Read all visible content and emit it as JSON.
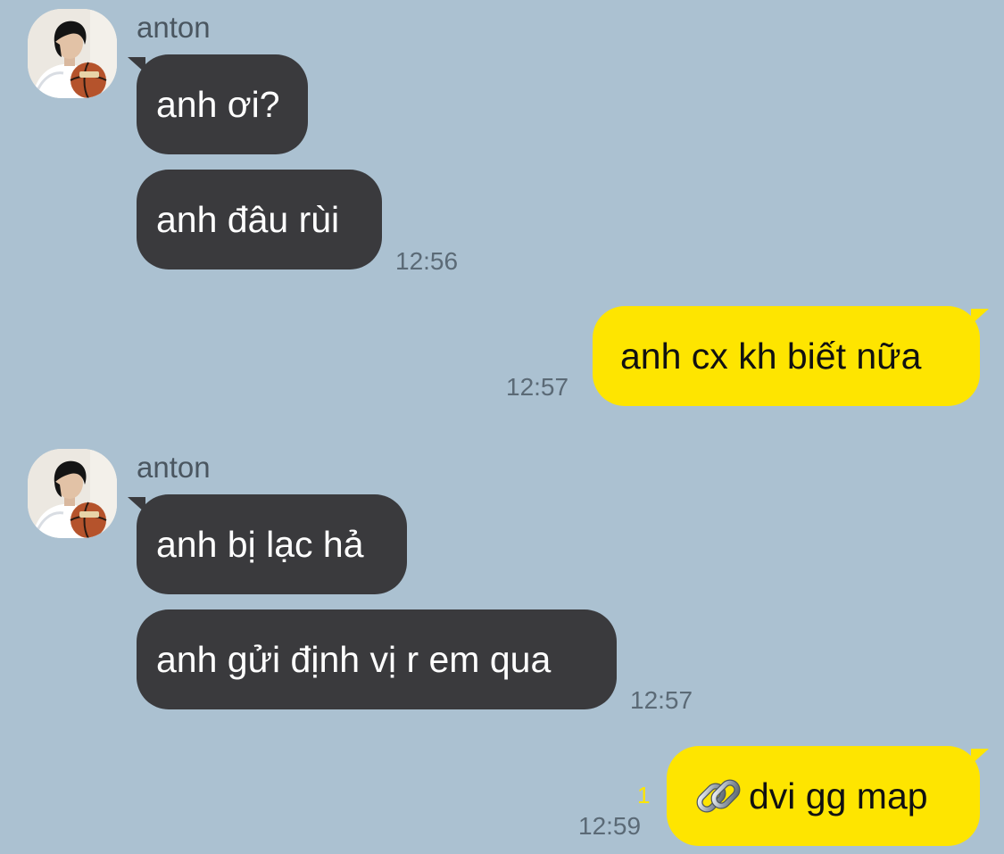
{
  "theme": {
    "background": "#abc1d1",
    "incoming_bubble": "#3a3a3d",
    "outgoing_bubble": "#fee500",
    "unread_color": "#fee500"
  },
  "messages": [
    {
      "direction": "in",
      "sender": "anton",
      "text": "anh ơi?"
    },
    {
      "direction": "in",
      "text": "anh đâu rùi",
      "time": "12:56"
    },
    {
      "direction": "out",
      "text": "anh cx kh biết nữa",
      "time": "12:57"
    },
    {
      "direction": "in",
      "sender": "anton",
      "text": "anh bị lạc hả"
    },
    {
      "direction": "in",
      "text": "anh gửi định vị r em qua",
      "time": "12:57"
    },
    {
      "direction": "out",
      "icon": "link-icon",
      "text": "dvi gg map",
      "time": "12:59",
      "unread": "1"
    }
  ]
}
